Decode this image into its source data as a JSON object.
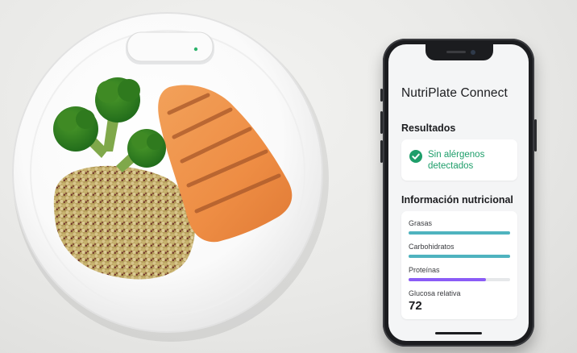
{
  "app": {
    "title": "NutriPlate Connect"
  },
  "results": {
    "heading": "Resultados",
    "status_icon": "check-circle-icon",
    "status_text": "Sin alérgenos detectados",
    "status_color": "#1e9e6a"
  },
  "nutrition": {
    "heading": "Información nutricional",
    "items": [
      {
        "label": "Grasas",
        "level": 1.0,
        "color": "#4fb3bf"
      },
      {
        "label": "Carbohidratos",
        "level": 1.0,
        "color": "#4fb3bf"
      },
      {
        "label": "Proteínas",
        "level": 0.76,
        "color": "#8b5cf6"
      }
    ],
    "glucose": {
      "label": "Glucosa relativa",
      "value": "72"
    }
  },
  "scene": {
    "plate_items": [
      "smart-sensor-device",
      "broccoli",
      "grilled-salmon",
      "quinoa"
    ]
  }
}
